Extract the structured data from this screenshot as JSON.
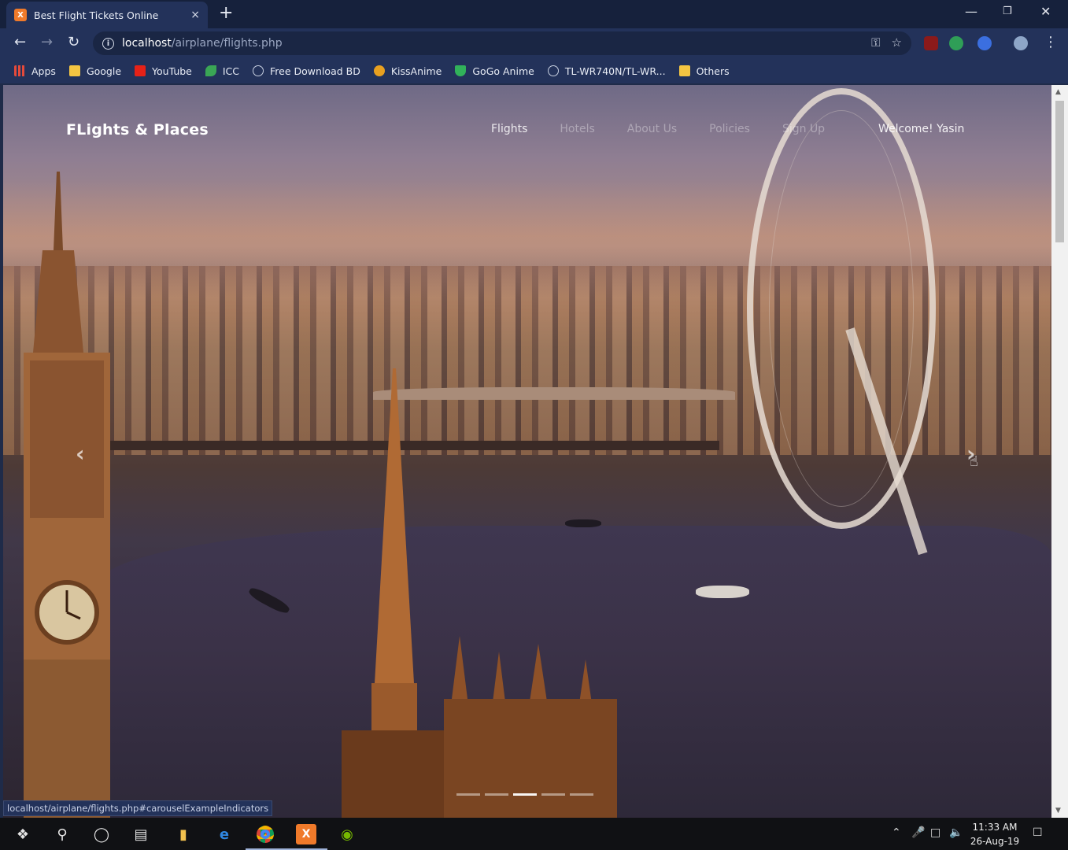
{
  "browser": {
    "tab_title": "Best Flight Tickets Online",
    "tab_favicon": "X",
    "tab_close": "×",
    "new_tab": "+",
    "url_host": "localhost",
    "url_path": "/airplane/flights.php",
    "status_url": "localhost/airplane/flights.php#carouselExampleIndicators"
  },
  "bookmarks": [
    {
      "label": "Apps",
      "color": "#e44a3b"
    },
    {
      "label": "Google",
      "color": "#f4c542"
    },
    {
      "label": "YouTube",
      "color": "#e62117"
    },
    {
      "label": "ICC",
      "color": "#3aa655"
    },
    {
      "label": "Free Download BD",
      "color": "#c7cfe0"
    },
    {
      "label": "KissAnime",
      "color": "#e8a020"
    },
    {
      "label": "GoGo Anime",
      "color": "#31b25a"
    },
    {
      "label": "TL-WR740N/TL-WR...",
      "color": "#c7cfe0"
    },
    {
      "label": "Others",
      "color": "#f4c542"
    }
  ],
  "site": {
    "brand": "FLights & Places",
    "nav": [
      "Flights",
      "Hotels",
      "About Us",
      "Policies",
      "Sign Up"
    ],
    "welcome": "Welcome! Yasin"
  },
  "carousel": {
    "prev": "‹",
    "next": "›",
    "active_slide": 3,
    "slide_count": 5
  },
  "taskbar": {
    "time": "11:33 AM",
    "date": "26-Aug-19"
  }
}
